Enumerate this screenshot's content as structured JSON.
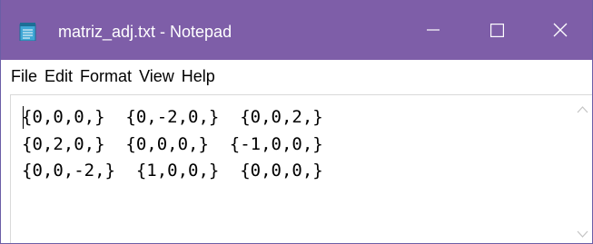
{
  "window": {
    "title": "matriz_adj.txt - Notepad",
    "controls": [
      "minimize",
      "maximize",
      "close"
    ]
  },
  "menu": {
    "items": [
      "File",
      "Edit",
      "Format",
      "View",
      "Help"
    ]
  },
  "document": {
    "lines": [
      "{0,0,0,}  {0,-2,0,}  {0,0,2,}",
      "{0,2,0,}  {0,0,0,}  {-1,0,0,}",
      "{0,0,-2,}  {1,0,0,}  {0,0,0,}"
    ]
  },
  "colors": {
    "titlebar": "#7e5ea8",
    "title_text": "#ffffff",
    "text": "#000000"
  },
  "icons": {
    "app": "notepad-icon",
    "minimize": "minimize-icon",
    "maximize": "maximize-icon",
    "close": "close-icon",
    "scroll_up": "scroll-up-arrow-icon",
    "scroll_down": "scroll-down-arrow-icon"
  }
}
